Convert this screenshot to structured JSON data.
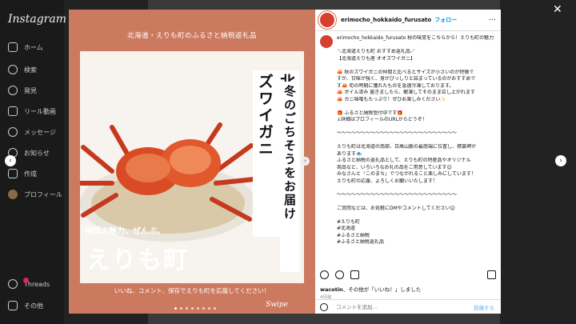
{
  "brand": {
    "logo": "Instagram"
  },
  "nav": [
    {
      "label": "ホーム",
      "icon": "home-icon"
    },
    {
      "label": "検索",
      "icon": "search-icon"
    },
    {
      "label": "発見",
      "icon": "compass-icon"
    },
    {
      "label": "リール動画",
      "icon": "reels-icon"
    },
    {
      "label": "メッセージ",
      "icon": "message-icon"
    },
    {
      "label": "お知らせ",
      "icon": "heart-icon"
    },
    {
      "label": "作成",
      "icon": "create-icon"
    },
    {
      "label": "プロフィール",
      "icon": "avatar-icon"
    }
  ],
  "nav_bottom": [
    {
      "label": "Threads",
      "icon": "threads-icon",
      "badge": "9+"
    },
    {
      "label": "その他",
      "icon": "menu-icon"
    }
  ],
  "post_image": {
    "top_text": "北海道・えりも町のふるさと納税返礼品",
    "vertical_1": "北海道えりも産オオズワイガニ",
    "vertical_2": "冬のごちそうをお届け",
    "subtitle": "地球の魅力、ぜんぶ。",
    "town": "えりも町",
    "tagline": "いいね、コメント、保存でえりも町を応援してください！",
    "swipe": "Swipe"
  },
  "side": {
    "username": "erimocho_hokkaido_furusato",
    "follow": "フォロー",
    "more": "…",
    "caption_lines": [
      "erimocho_hokkaido_furusato 秋の味覚をこちらから！えりも町の魅力をご紹介",
      "",
      "＼北海道えりも町 おすすめ返礼品／",
      "【北海道えりも産 オオズワイガニ】",
      "",
      "🦀 秋のズワイガニの仲間と比べるとサイズが小さいのが特徴で",
      "すが、甘味が強く、身がびっしりと詰まっているのがおすすめで",
      "す🦀 旬の時期に獲れたものを急速冷凍しております。",
      "🦀 ボイル済み 届きましたら、解凍してそのまま召し上がれます",
      "🦀 カニ味噌もたっぷり！ぜひお楽しみください✨",
      "",
      "🎁 ふるさと納税受付中です🎁",
      "↓詳細はプロフィールのURLからどうぞ！",
      "",
      "〜〜〜〜〜〜〜〜〜〜〜〜〜〜〜〜〜〜〜〜〜〜〜〜〜",
      "",
      "えりも町は北海道の南部、日高山脈の最南端に位置し、襟裳岬が",
      "あります🐟",
      "ふるさと納税の返礼品として、えりも町の特産品やオリジナル",
      "商品など、いろいろなお礼の品をご用意しています😊",
      "みなさんと「このまち」でつながれること楽しみにしています！",
      "えりも町の応援、よろしくお願いいたします！",
      "",
      "〜〜〜〜〜〜〜〜〜〜〜〜〜〜〜〜〜〜〜〜〜〜〜〜〜",
      "",
      "ご質問などは、お気軽にDMやコメントしてください😊",
      "",
      "#えりも町",
      "#北海道",
      "#ふるさと納税",
      "#ふるさと納税返礼品"
    ],
    "likes_user": "wacotin",
    "likes_text": "、その他が「いいね！」しました",
    "date": "4日前",
    "comment_placeholder": "コメントを追加...",
    "post_label": "投稿する"
  },
  "controls": {
    "close": "✕",
    "prev": "‹",
    "next": "›",
    "carousel_next": "›"
  }
}
